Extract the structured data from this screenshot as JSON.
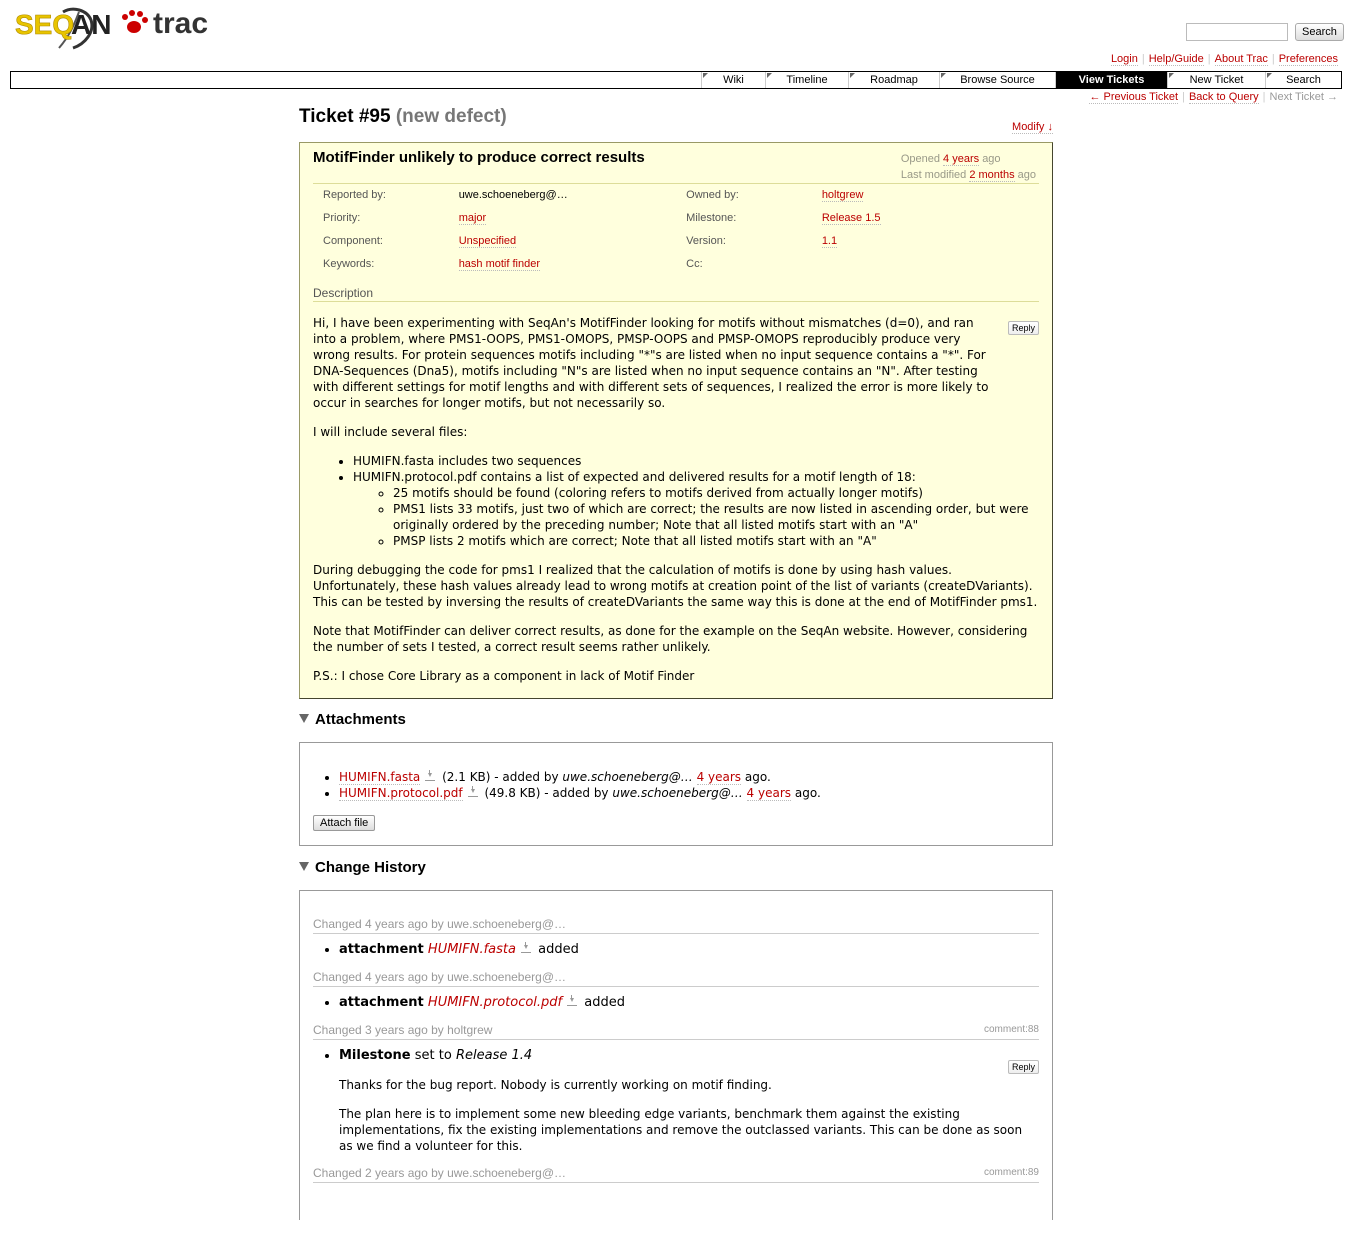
{
  "logo": {
    "left": "SEQAN",
    "right": "trac"
  },
  "search": {
    "placeholder": "",
    "button": "Search"
  },
  "metanav": [
    "Login",
    "Help/Guide",
    "About Trac",
    "Preferences"
  ],
  "mainnav": [
    "Wiki",
    "Timeline",
    "Roadmap",
    "Browse Source",
    "View Tickets",
    "New Ticket",
    "Search"
  ],
  "mainnav_active": "View Tickets",
  "ctxtnav": {
    "prev": "← Previous Ticket",
    "back": "Back to Query",
    "next": "Next Ticket →"
  },
  "ticket": {
    "title": "Ticket #95",
    "status": "(new defect)",
    "modify": "Modify ↓",
    "summary": "MotifFinder unlikely to produce correct results",
    "opened_prefix": "Opened",
    "opened": "4 years",
    "opened_suffix": "ago",
    "modified_prefix": "Last modified",
    "modified": "2 months",
    "modified_suffix": "ago",
    "props": {
      "reported_by_label": "Reported by:",
      "reported_by": "uwe.schoeneberg@…",
      "owned_by_label": "Owned by:",
      "owned_by": "holtgrew",
      "priority_label": "Priority:",
      "priority": "major",
      "milestone_label": "Milestone:",
      "milestone": "Release 1.5",
      "component_label": "Component:",
      "component": "Unspecified",
      "version_label": "Version:",
      "version": "1.1",
      "keywords_label": "Keywords:",
      "keywords": "hash motif finder",
      "cc_label": "Cc:",
      "cc": ""
    },
    "description_label": "Description",
    "reply": "Reply",
    "description": {
      "p1": "Hi, I have been experimenting with SeqAn's MotifFinder looking for motifs without mismatches (d=0), and ran into a problem, where PMS1-OOPS, PMS1-OMOPS, PMSP-OOPS and PMSP-OMOPS reproducibly produce very wrong results. For protein sequences motifs including \"*\"s are listed when no input sequence contains a \"*\". For DNA-Sequences (Dna5), motifs including \"N\"s are listed when no input sequence contains an \"N\". After testing with different settings for motif lengths and with different sets of sequences, I realized the error is more likely to occur in searches for longer motifs, but not necessarily so.",
      "p2": "I will include several files:",
      "li1": "HUMIFN.fasta includes two sequences",
      "li2": "HUMIFN.protocol.pdf contains a list of expected and delivered results for a motif length of 18:",
      "sub1": "25 motifs should be found (coloring refers to motifs derived from actually longer motifs)",
      "sub2": "PMS1 lists 33 motifs, just two of which are correct; the results are now listed in ascending order, but were originally ordered by the preceding number; Note that all listed motifs start with an \"A\"",
      "sub3": "PMSP lists 2 motifs which are correct; Note that all listed motifs start with an \"A\"",
      "p3": "During debugging the code for pms1 I realized that the calculation of motifs is done by using hash values. Unfortunately, these hash values already lead to wrong motifs at creation point of the list of variants (createDVariants). This can be tested by inversing the results of createDVariants the same way this is done at the end of MotifFinder pms1.",
      "p4": "Note that MotifFinder can deliver correct results, as done for the example on the SeqAn website. However, considering the number of sets I tested, a correct result seems rather unlikely.",
      "p5": "P.S.: I chose Core Library as a component in lack of Motif Finder"
    }
  },
  "attachments": {
    "heading": "Attachments",
    "items": [
      {
        "name": "HUMIFN.fasta",
        "size": "(2.1 KB) - added by",
        "author": "uwe.schoeneberg@…",
        "when": "4 years",
        "ago": "ago."
      },
      {
        "name": "HUMIFN.protocol.pdf",
        "size": "(49.8 KB) - added by",
        "author": "uwe.schoeneberg@…",
        "when": "4 years",
        "ago": "ago."
      }
    ],
    "attach_button": "Attach file"
  },
  "history": {
    "heading": "Change History",
    "changes": [
      {
        "head": "Changed 4 years ago by uwe.schoeneberg@…",
        "field": "attachment",
        "value": "HUMIFN.fasta",
        "action": "added"
      },
      {
        "head": "Changed 4 years ago by uwe.schoeneberg@…",
        "field": "attachment",
        "value": "HUMIFN.protocol.pdf",
        "action": "added"
      },
      {
        "head": "Changed 3 years ago by holtgrew",
        "comment": "comment:88",
        "field": "Milestone",
        "set_to": "set to",
        "value": "Release 1.4",
        "reply": "Reply",
        "p1": "Thanks for the bug report. Nobody is currently working on motif finding.",
        "p2": "The plan here is to implement some new bleeding edge variants, benchmark them against the existing implementations, fix the existing implementations and remove the outclassed variants. This can be done as soon as we find a volunteer for this."
      },
      {
        "head": "Changed 2 years ago by uwe.schoeneberg@…",
        "comment": "comment:89"
      }
    ]
  }
}
